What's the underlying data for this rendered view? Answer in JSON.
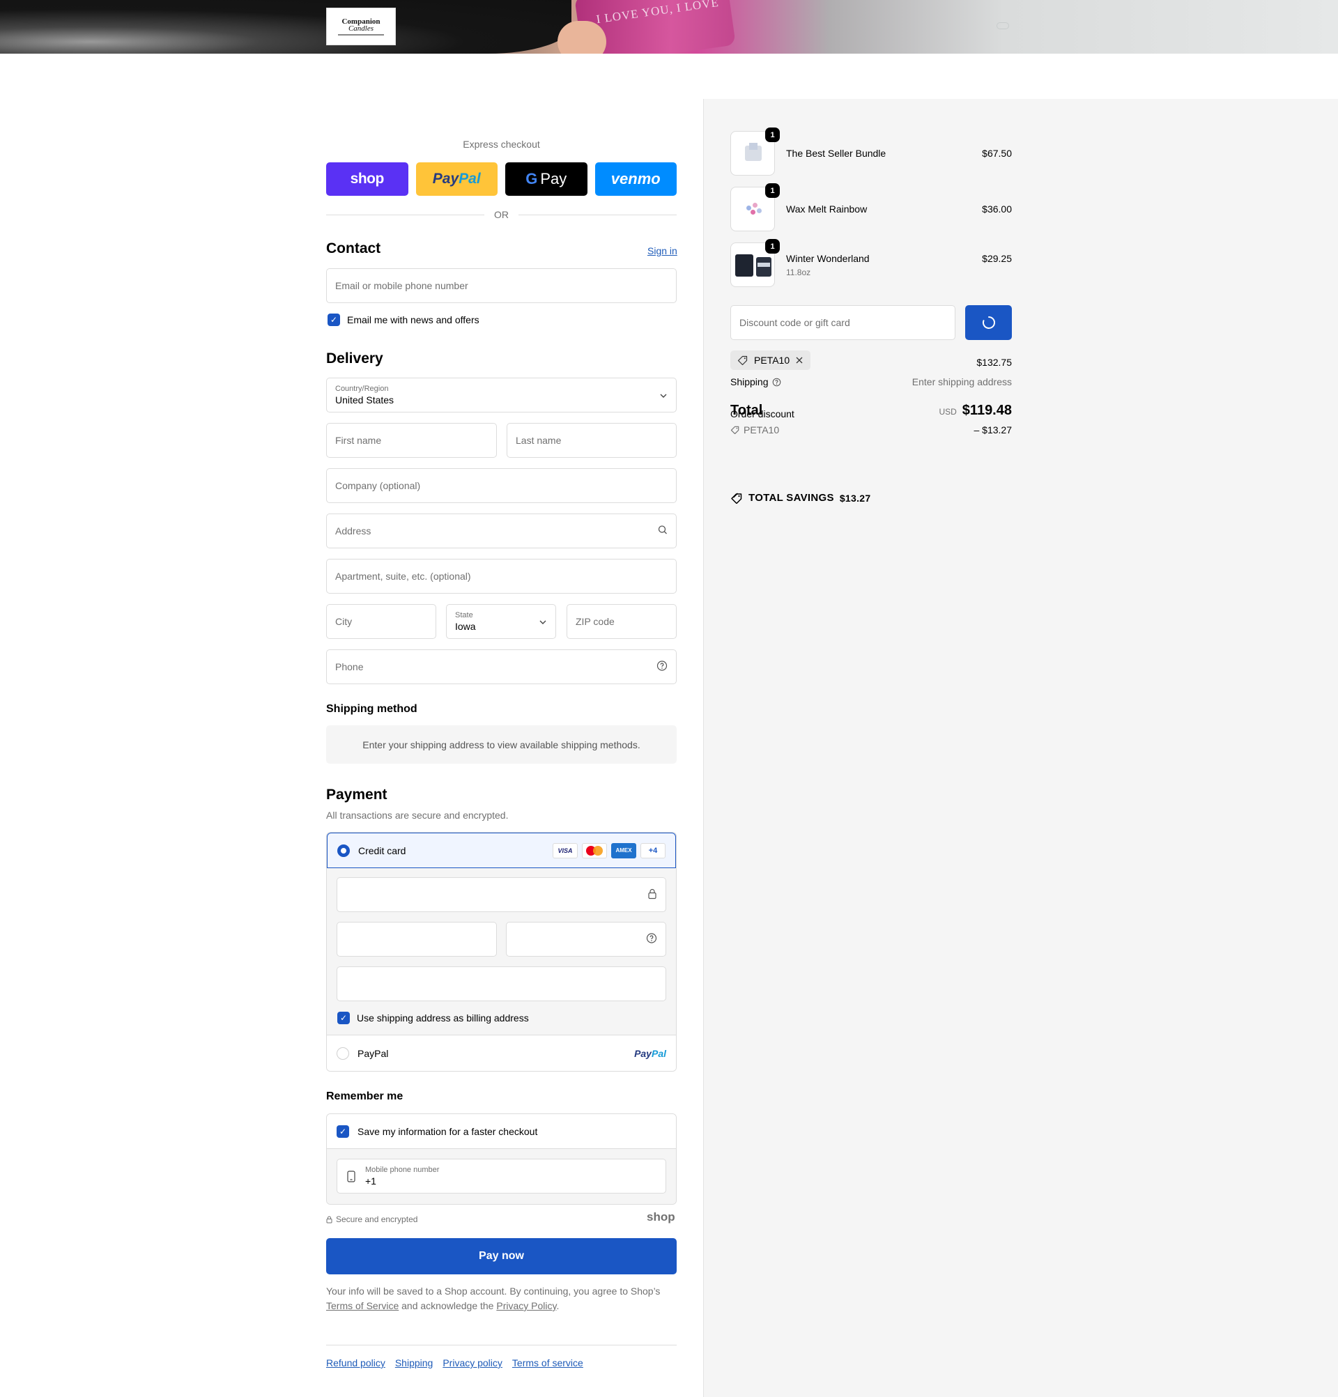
{
  "header": {
    "logo_line1": "Companion",
    "logo_line2": "Candles",
    "banner_jar_text": "I LOVE YOU, I LOVE"
  },
  "express": {
    "title": "Express checkout",
    "shop": "shop",
    "paypal_1": "Pay",
    "paypal_2": "Pal",
    "gpay_g": "G",
    "gpay_pay": "Pay",
    "venmo": "venmo",
    "or": "OR"
  },
  "contact": {
    "title": "Contact",
    "sign_in": "Sign in",
    "email_placeholder": "Email or mobile phone number",
    "newsletter_label": "Email me with news and offers"
  },
  "delivery": {
    "title": "Delivery",
    "country_label": "Country/Region",
    "country_value": "United States",
    "first_name": "First name",
    "last_name": "Last name",
    "company": "Company (optional)",
    "address": "Address",
    "apartment": "Apartment, suite, etc. (optional)",
    "city": "City",
    "state_label": "State",
    "state_value": "Iowa",
    "zip": "ZIP code",
    "phone": "Phone"
  },
  "shipping_method": {
    "title": "Shipping method",
    "info": "Enter your shipping address to view available shipping methods."
  },
  "payment": {
    "title": "Payment",
    "subtitle": "All transactions are secure and encrypted.",
    "credit_card": "Credit card",
    "cards": [
      "VISA",
      "AMEX",
      "+4"
    ],
    "billing_label": "Use shipping address as billing address",
    "paypal": "PayPal"
  },
  "remember": {
    "title": "Remember me",
    "save_label": "Save my information for a faster checkout",
    "phone_label": "Mobile phone number",
    "phone_value": "+1",
    "secure": "Secure and encrypted",
    "shop": "shop"
  },
  "pay_now": "Pay now",
  "legal": {
    "line1": "Your info will be saved to a Shop account. By continuing, you agree to Shop’s",
    "tos": "Terms of Service",
    "middle": " and acknowledge the ",
    "privacy": "Privacy Policy",
    "end": "."
  },
  "footer_links": [
    "Refund policy",
    "Shipping",
    "Privacy policy",
    "Terms of service"
  ],
  "summary": {
    "items": [
      {
        "name": "The Best Seller Bundle",
        "qty": "1",
        "price": "$67.50",
        "variant": ""
      },
      {
        "name": "Wax Melt Rainbow",
        "qty": "1",
        "price": "$36.00",
        "variant": ""
      },
      {
        "name": "Winter Wonderland",
        "qty": "1",
        "price": "$29.25",
        "variant": "11.8oz"
      }
    ],
    "discount_placeholder": "Discount code or gift card",
    "applied_code": "PETA10",
    "subtotal": "$132.75",
    "shipping_label": "Shipping",
    "shipping_value": "Enter shipping address",
    "total_label": "Total",
    "order_discount_label": "Order discount",
    "currency": "USD",
    "total_value": "$119.48",
    "discount_code": "PETA10",
    "discount_value": "– $13.27",
    "savings_label": "TOTAL SAVINGS",
    "savings_value": "$13.27"
  },
  "colors": {
    "accent": "#1a56c4",
    "shop_purple": "#5a31f4",
    "paypal_yellow": "#ffc439",
    "venmo_blue": "#008cff",
    "summary_bg": "#f5f5f5"
  }
}
